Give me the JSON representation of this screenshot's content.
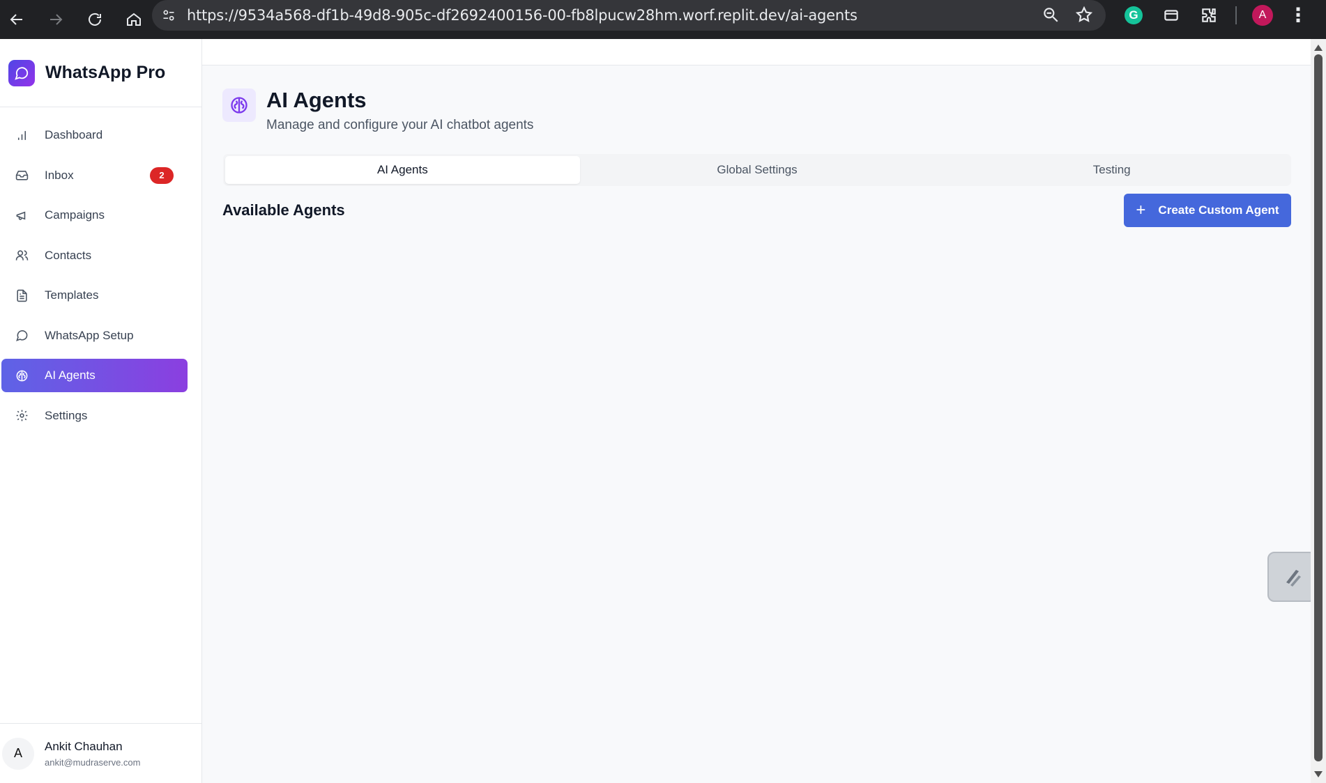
{
  "browser": {
    "url": "https://9534a568-df1b-49d8-905c-df2692400156-00-fb8lpucw28hm.worf.replit.dev/ai-agents",
    "profile_initial": "A"
  },
  "brand": {
    "name": "WhatsApp Pro"
  },
  "sidebar": {
    "items": [
      {
        "label": "Dashboard",
        "icon": "bar-chart-icon"
      },
      {
        "label": "Inbox",
        "icon": "inbox-icon",
        "badge": "2"
      },
      {
        "label": "Campaigns",
        "icon": "megaphone-icon"
      },
      {
        "label": "Contacts",
        "icon": "users-icon"
      },
      {
        "label": "Templates",
        "icon": "file-text-icon"
      },
      {
        "label": "WhatsApp Setup",
        "icon": "message-circle-icon"
      },
      {
        "label": "AI Agents",
        "icon": "brain-icon",
        "active": true
      },
      {
        "label": "Settings",
        "icon": "gear-icon"
      }
    ]
  },
  "user": {
    "initial": "A",
    "name": "Ankit Chauhan",
    "email": "ankit@mudraserve.com"
  },
  "page": {
    "title": "AI Agents",
    "subtitle": "Manage and configure your AI chatbot agents"
  },
  "tabs": [
    {
      "label": "AI Agents",
      "active": true
    },
    {
      "label": "Global Settings"
    },
    {
      "label": "Testing"
    }
  ],
  "section": {
    "title": "Available Agents",
    "create_button": "Create Custom Agent"
  },
  "colors": {
    "accent": "#4568dc",
    "active_gradient_start": "#5e63e6",
    "active_gradient_end": "#8b3fe0",
    "badge": "#dc2626"
  }
}
